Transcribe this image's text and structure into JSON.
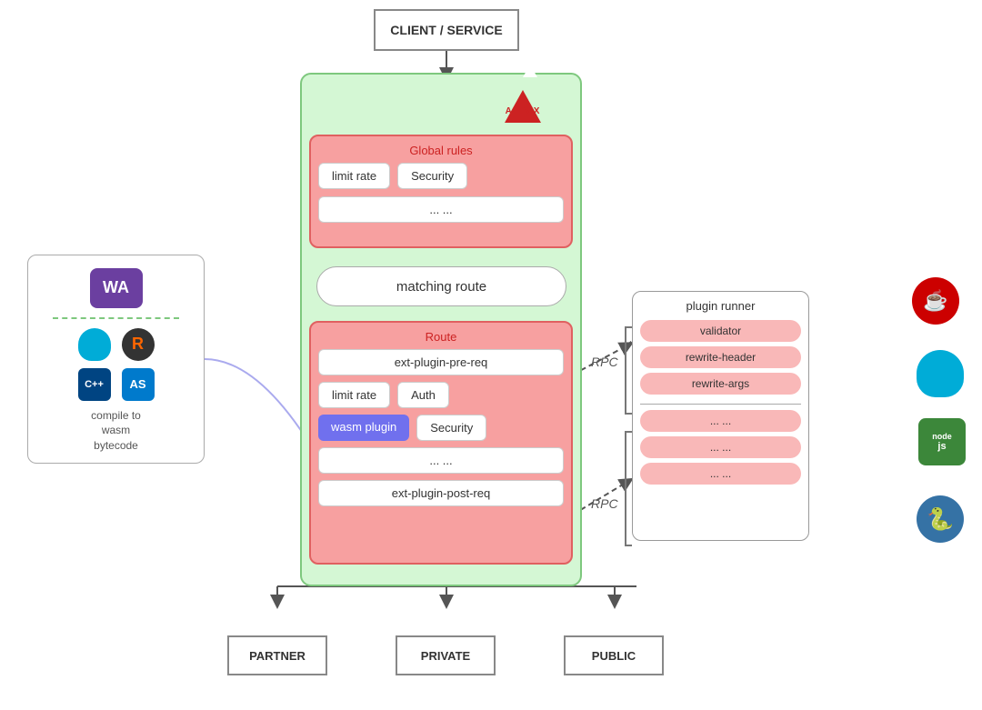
{
  "client": {
    "label": "CLIENT / SERVICE"
  },
  "apisix": {
    "label": "APISIX"
  },
  "global_rules": {
    "label": "Global rules",
    "items": [
      "limit rate",
      "Security",
      "... ..."
    ]
  },
  "matching_route": {
    "label": "matching route"
  },
  "route": {
    "label": "Route",
    "rows": [
      [
        "ext-plugin-pre-req"
      ],
      [
        "limit rate",
        "Auth"
      ],
      [
        "wasm plugin",
        "Security"
      ],
      [
        "... ..."
      ],
      [
        "ext-plugin-post-req"
      ]
    ]
  },
  "plugin_runner": {
    "label": "plugin runner",
    "items_top": [
      "validator",
      "rewrite-header",
      "rewrite-args"
    ],
    "items_bottom": [
      "... ...",
      "... ...",
      "... ..."
    ]
  },
  "rpc1": {
    "label": "RPC"
  },
  "rpc2": {
    "label": "RPC"
  },
  "wasm_box": {
    "wa_label": "WA",
    "compile_label": "compile to\nwasm\nbytecode"
  },
  "bottom": {
    "partner": "PARTNER",
    "private": "PRIVATE",
    "public": "PUBLIC"
  },
  "java_icon": {
    "label": "☕"
  },
  "node_icon": {
    "label": "node"
  },
  "python_icon": {
    "label": "🐍"
  }
}
